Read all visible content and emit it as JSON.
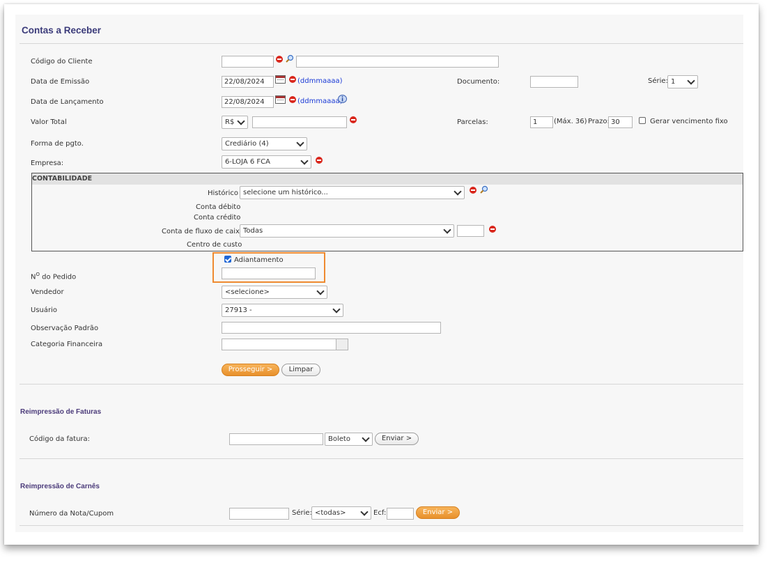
{
  "page": {
    "title": "Contas a Receber"
  },
  "form": {
    "codigo_cliente": {
      "label": "Código do Cliente",
      "value": "",
      "name_value": ""
    },
    "data_emissao": {
      "label": "Data de Emissão",
      "value": "22/08/2024",
      "format_hint": "(ddmmaaaa)"
    },
    "documento": {
      "label": "Documento:",
      "value": ""
    },
    "serie": {
      "label": "Série:",
      "value": "1"
    },
    "data_lancamento": {
      "label": "Data de Lançamento",
      "value": "22/08/2024",
      "format_hint": "(ddmmaaaa)"
    },
    "valor_total": {
      "label": "Valor Total",
      "currency": "R$",
      "value": ""
    },
    "parcelas": {
      "label": "Parcelas:",
      "value": "1",
      "max_hint": "(Máx. 36)",
      "prazo_label": "Prazo:",
      "prazo_value": "30",
      "gerar_label": "Gerar vencimento fixo",
      "gerar_checked": false
    },
    "forma_pgto": {
      "label": "Forma de pgto.",
      "value": "Crediário (4)"
    },
    "empresa": {
      "label": "Empresa:",
      "value": "6-LOJA 6 FCA"
    },
    "contabilidade": {
      "header": "CONTABILIDADE",
      "historico_label": "Histórico",
      "historico_value": "selecione um histórico...",
      "conta_debito_label": "Conta débito",
      "conta_credito_label": "Conta crédito",
      "fluxo_label": "Conta de fluxo de caixa",
      "fluxo_value": "Todas",
      "fluxo_code": "",
      "centro_custo_label": "Centro de custo"
    },
    "adiantamento": {
      "label": "Adiantamento",
      "checked": true
    },
    "pedido": {
      "label_prefix": "N",
      "label_sup": "O",
      "label_suffix": " do Pedido",
      "value": ""
    },
    "vendedor": {
      "label": "Vendedor",
      "value": "<selecione>"
    },
    "usuario": {
      "label": "Usuário",
      "value": "27913 -"
    },
    "observacao": {
      "label": "Observação Padrão",
      "value": ""
    },
    "categoria": {
      "label": "Categoria Financeira",
      "value": ""
    },
    "buttons": {
      "prosseguir": "Prosseguir >",
      "limpar": "Limpar"
    }
  },
  "reimpressao_faturas": {
    "title": "Reimpressão de Faturas",
    "codigo_label": "Código da fatura:",
    "codigo_value": "",
    "tipo_value": "Boleto",
    "enviar": "Enviar >"
  },
  "reimpressao_carnes": {
    "title": "Reimpressão de Carnês",
    "numero_label": "Número da Nota/Cupom",
    "numero_value": "",
    "serie_label": "Série:",
    "serie_value": "<todas>",
    "ecf_label": "Ecf:",
    "ecf_value": "",
    "enviar": "Enviar >"
  },
  "colors": {
    "title": "#3b3b7a",
    "accent": "#ef8a30",
    "link": "#1a3ad6",
    "error_icon": "#d9271c"
  }
}
